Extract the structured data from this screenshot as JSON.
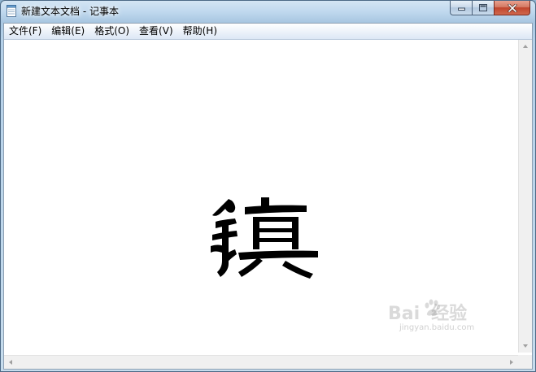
{
  "window": {
    "title": "新建文本文档 - 记事本",
    "icon": "notepad-icon"
  },
  "caption_buttons": {
    "minimize_icon": "minimize-icon",
    "maximize_icon": "maximize-icon",
    "close_icon": "close-icon"
  },
  "menubar": {
    "items": [
      {
        "label": "文件(F)"
      },
      {
        "label": "编辑(E)"
      },
      {
        "label": "格式(O)"
      },
      {
        "label": "查看(V)"
      },
      {
        "label": "帮助(H)"
      }
    ]
  },
  "document": {
    "content": "镇"
  },
  "watermark": {
    "brand": "Bai",
    "brand2": "经验",
    "url": "jingyan.baidu.com"
  },
  "colors": {
    "frame": "#bfd8ee",
    "close_button": "#c0452c",
    "glyph": "#000000"
  }
}
